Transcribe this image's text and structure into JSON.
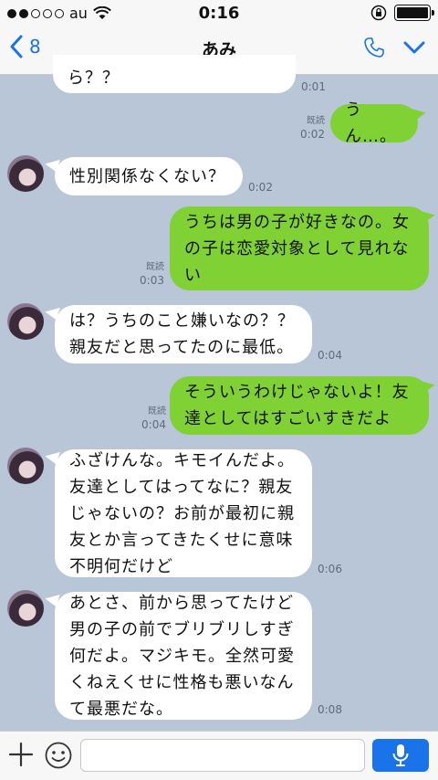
{
  "status_bar": {
    "carrier": "au",
    "time": "0:16"
  },
  "nav": {
    "back_count": "8",
    "title": "あみ"
  },
  "messages": [
    {
      "side": "left",
      "text": "ら？？",
      "time": "0:01"
    },
    {
      "side": "right",
      "text": "うん…。",
      "read": "既読",
      "time": "0:02"
    },
    {
      "side": "left",
      "text": "性別関係なくない？",
      "time": "0:02"
    },
    {
      "side": "right",
      "text": "うちは男の子が好きなの。女\nの子は恋愛対象として見れな\nい",
      "read": "既読",
      "time": "0:03"
    },
    {
      "side": "left",
      "text": "は？うちのこと嫌いなの？？\n親友だと思ってたのに最低。",
      "time": "0:04"
    },
    {
      "side": "right",
      "text": "そういうわけじゃないよ！友\n達としてはすごいすきだよ",
      "read": "既読",
      "time": "0:04"
    },
    {
      "side": "left",
      "text": "ふざけんな。キモイんだよ。\n友達としてはってなに？親友\nじゃないの？お前が最初に親\n友とか言ってきたくせに意味\n不明何だけど",
      "time": "0:06"
    },
    {
      "side": "left",
      "text": "あとさ、前から思ってたけど\n男の子の前でブリブリしすぎ\n何だよ。マジキモ。全然可愛\nくねえくせに性格も悪いなん\nて最悪だな。",
      "time": "0:08"
    }
  ],
  "input": {
    "value": ""
  }
}
